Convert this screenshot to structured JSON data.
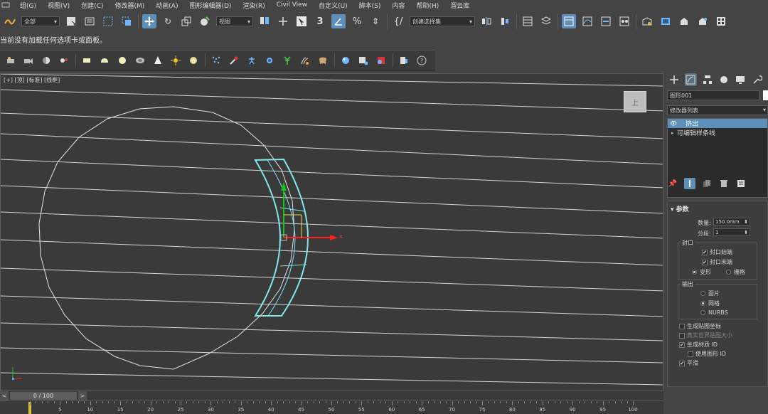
{
  "menu": {
    "items": [
      "组(G)",
      "视图(V)",
      "创建(C)",
      "修改器(M)",
      "动画(A)",
      "图形编辑器(D)",
      "渲染(R)",
      "Civil View",
      "自定义(U)",
      "脚本(S)",
      "内容",
      "帮助(H)",
      "溜云库"
    ]
  },
  "toolbar": {
    "selection_filter": "全部",
    "ref_coord": "视图",
    "named_selection": "创建选择集"
  },
  "status": {
    "message": "当前没有加载任何选项卡或面板。"
  },
  "viewport": {
    "label": "[+] [顶] [标准] [线框]",
    "viewcube_face": "上",
    "x_axis_label": "x",
    "colors": {
      "grid": "#d8d8d8",
      "selection": "#7fe8ea",
      "gizmo_x": "#ff2020",
      "gizmo_y": "#19c219"
    }
  },
  "command_panel": {
    "object_name": "图形001",
    "modifier_list": "修改器列表",
    "stack": [
      {
        "label": "挤出",
        "selected": true
      },
      {
        "label": "可编辑样条线",
        "selected": false
      }
    ],
    "rollout_title": "参数",
    "amount_label": "数量:",
    "amount_value": "150.0mm",
    "segments_label": "分段:",
    "segments_value": "1",
    "capping": {
      "title": "封口",
      "cap_start": "封口始端",
      "cap_end": "封口末端",
      "morph": "变形",
      "grid": "栅格"
    },
    "output": {
      "title": "输出",
      "patch": "面片",
      "mesh": "网格",
      "nurbs": "NURBS"
    },
    "gen_mapping": "生成贴图坐标",
    "real_world": "真实世界贴图大小",
    "gen_mat_ids": "生成材质 ID",
    "use_shape_ids": "使用图形 ID",
    "smooth": "平滑"
  },
  "timeline": {
    "frame_display": "0 / 100",
    "ticks": [
      "5",
      "10",
      "15",
      "20",
      "25",
      "30",
      "35",
      "40",
      "45",
      "50",
      "55",
      "60",
      "65",
      "70",
      "75",
      "80",
      "85",
      "90",
      "95",
      "100"
    ]
  }
}
